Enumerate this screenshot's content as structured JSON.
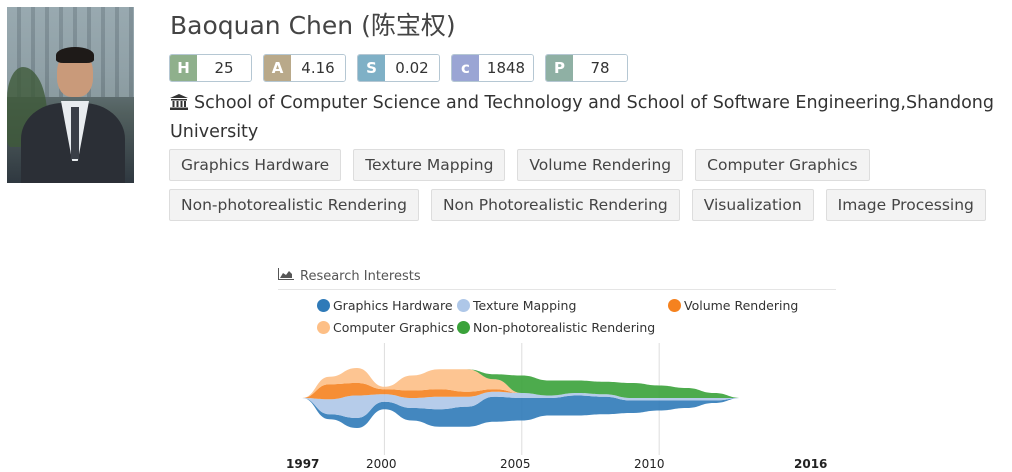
{
  "profile": {
    "name": "Baoquan Chen (陈宝权)",
    "metrics": [
      {
        "key": "H",
        "value": "25",
        "color": "#8fb08c"
      },
      {
        "key": "A",
        "value": "4.16",
        "color": "#b9a98a"
      },
      {
        "key": "S",
        "value": "0.02",
        "color": "#7fb0c6"
      },
      {
        "key": "c",
        "value": "1848",
        "color": "#9aa5d4"
      },
      {
        "key": "P",
        "value": "78",
        "color": "#8fb0a4"
      }
    ],
    "affiliation_icon": "institution-icon",
    "affiliation": "School of Computer Science and Technology and School of Software Engineering,Shandong University",
    "tags": [
      "Graphics Hardware",
      "Texture Mapping",
      "Volume Rendering",
      "Computer Graphics",
      "Non-photorealistic Rendering",
      "Non Photorealistic Rendering",
      "Visualization",
      "Image Processing"
    ]
  },
  "research": {
    "title": "Research Interests",
    "title_icon": "area-chart-icon"
  },
  "chart_data": {
    "type": "area",
    "title": "Research Interests",
    "x_ticks": [
      "1997",
      "2000",
      "2005",
      "2010",
      "2016"
    ],
    "x_range": [
      1997,
      2016
    ],
    "legend_position": "top",
    "grid": true,
    "series": [
      {
        "name": "Graphics Hardware",
        "color": "#2f7ab8",
        "x": [
          1997,
          1998,
          1999,
          2000,
          2001,
          2002,
          2003,
          2004,
          2005,
          2006,
          2007,
          2008,
          2009,
          2010,
          2011,
          2012,
          2013
        ],
        "values": [
          0,
          2,
          4,
          3,
          5,
          7,
          8,
          10,
          9,
          7,
          8,
          7,
          5,
          4,
          3,
          1,
          0
        ]
      },
      {
        "name": "Texture Mapping",
        "color": "#aec7e8",
        "x": [
          1997,
          1998,
          1999,
          2000,
          2001,
          2002,
          2003,
          2004,
          2005,
          2006,
          2007,
          2008,
          2009,
          2010,
          2011,
          2012,
          2013
        ],
        "values": [
          0,
          6,
          9,
          3,
          4,
          5,
          4,
          2,
          2,
          1,
          1,
          1,
          1,
          1,
          1,
          1,
          0
        ]
      },
      {
        "name": "Volume Rendering",
        "color": "#f5821f",
        "x": [
          1997,
          1998,
          1999,
          2000,
          2001,
          2002,
          2003,
          2004,
          2005,
          2006,
          2007,
          2008,
          2009,
          2010,
          2011,
          2012,
          2013
        ],
        "values": [
          0,
          6,
          5,
          2,
          3,
          3,
          2,
          1,
          0,
          0,
          0,
          0,
          0,
          0,
          0,
          0,
          0
        ]
      },
      {
        "name": "Computer Graphics",
        "color": "#fdbf86",
        "x": [
          1997,
          1998,
          1999,
          2000,
          2001,
          2002,
          2003,
          2004,
          2005,
          2006,
          2007,
          2008,
          2009,
          2010,
          2011,
          2012,
          2013
        ],
        "values": [
          0,
          3,
          6,
          1,
          6,
          8,
          9,
          4,
          0,
          0,
          0,
          0,
          0,
          0,
          0,
          0,
          0
        ]
      },
      {
        "name": "Non-photorealistic Rendering",
        "color": "#3aa23a",
        "x": [
          1997,
          1998,
          1999,
          2000,
          2001,
          2002,
          2003,
          2004,
          2005,
          2006,
          2007,
          2008,
          2009,
          2010,
          2011,
          2012,
          2013
        ],
        "values": [
          0,
          0,
          0,
          0,
          0,
          0,
          0,
          2,
          7,
          6,
          5,
          5,
          6,
          5,
          4,
          2,
          0
        ]
      }
    ]
  }
}
